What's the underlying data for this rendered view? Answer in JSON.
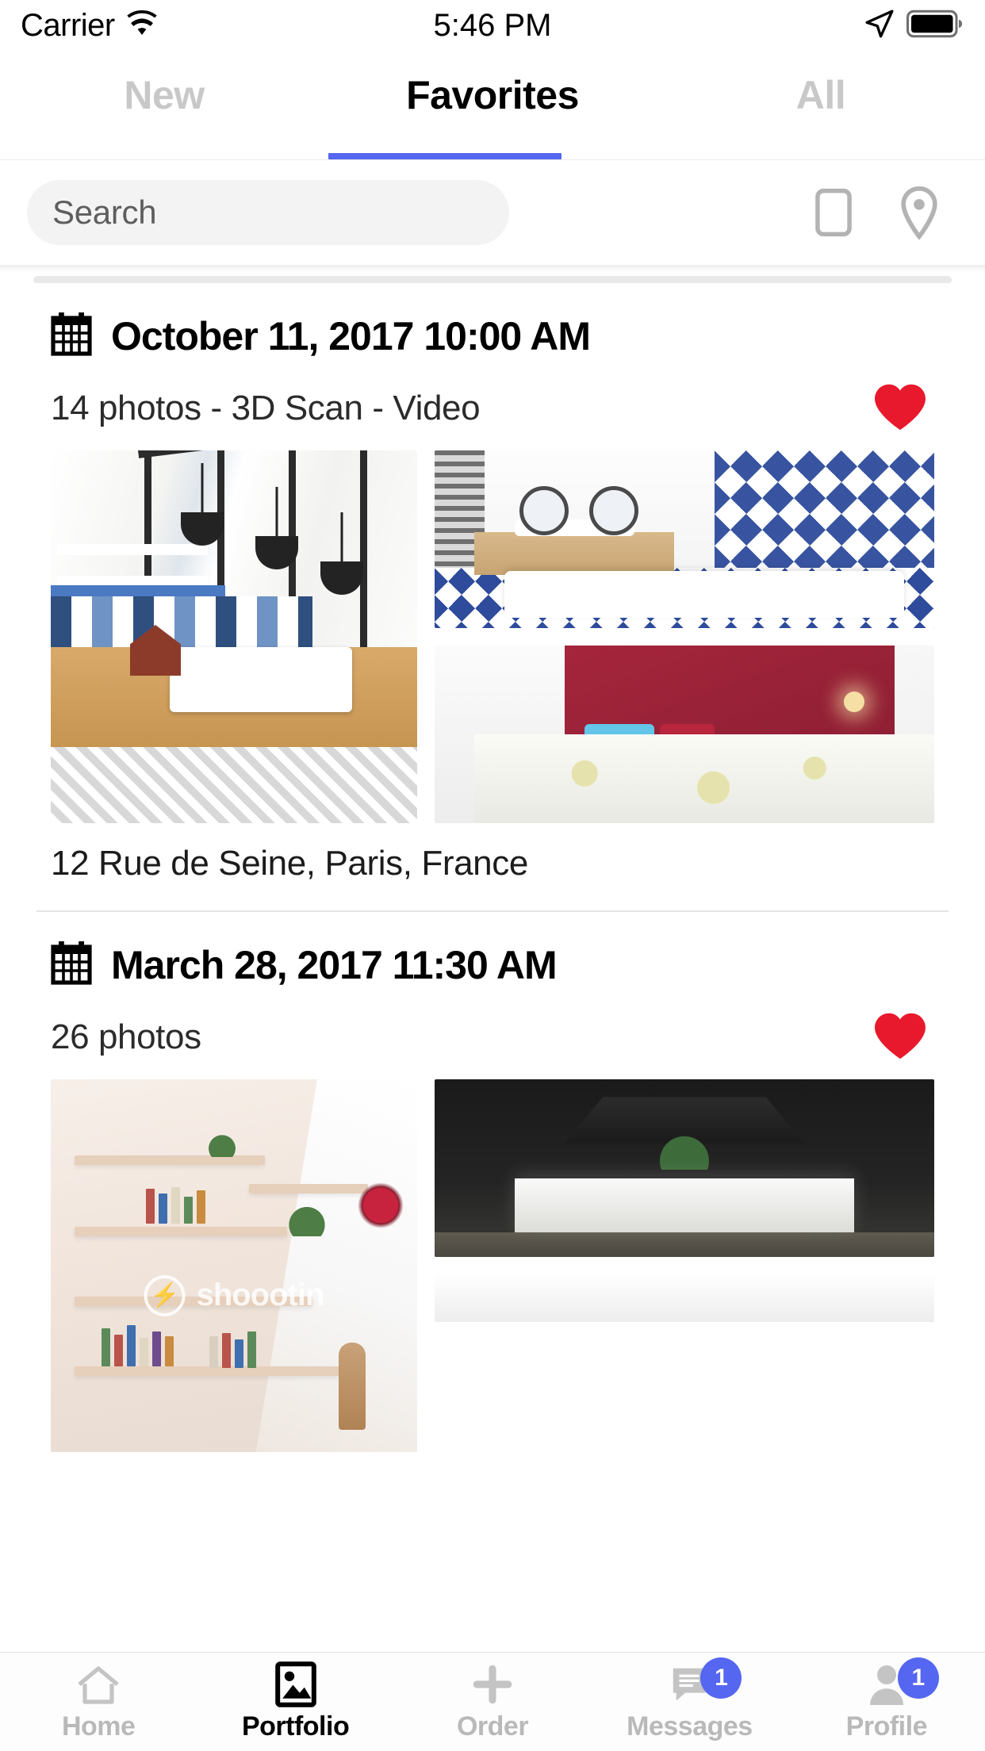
{
  "status_bar": {
    "carrier": "Carrier",
    "time": "5:46 PM",
    "wifi_icon": "wifi-icon",
    "location_icon": "location-arrow-icon",
    "battery_icon": "battery-full-icon"
  },
  "tabs": {
    "items": [
      {
        "label": "New",
        "active": false
      },
      {
        "label": "Favorites",
        "active": true
      },
      {
        "label": "All",
        "active": false
      }
    ],
    "active_indicator_color": "#5566f0"
  },
  "search": {
    "placeholder": "Search",
    "value": "",
    "actions": [
      {
        "name": "list-view-icon",
        "label": "List view"
      },
      {
        "name": "map-pin-icon",
        "label": "Map"
      }
    ]
  },
  "listings": [
    {
      "date": "October 11, 2017 10:00 AM",
      "meta": "14 photos - 3D Scan - Video",
      "address": "12 Rue de Seine, Paris, France",
      "favorite": true,
      "favorite_color": "#e8192c",
      "photos": [
        {
          "name": "kitchen-veranda-photo",
          "alt": "Kitchen with veranda windows"
        },
        {
          "name": "bathroom-photo",
          "alt": "Bathroom with blue patterned tiles"
        },
        {
          "name": "bedroom-photo",
          "alt": "Bedroom with red accent wall"
        }
      ]
    },
    {
      "date": "March 28, 2017 11:30 AM",
      "meta": "26 photos",
      "address": "",
      "favorite": true,
      "favorite_color": "#e8192c",
      "photos": [
        {
          "name": "library-shelves-photo",
          "alt": "Bookshelves under staircase"
        },
        {
          "name": "dark-kitchen-photo",
          "alt": "Dark modern kitchen island"
        },
        {
          "name": "light-room-photo",
          "alt": "Bright room partial view"
        }
      ],
      "watermark": "shoootin"
    }
  ],
  "bottom_nav": {
    "items": [
      {
        "label": "Home",
        "icon": "home-icon",
        "active": false,
        "badge": ""
      },
      {
        "label": "Portfolio",
        "icon": "photo-icon",
        "active": true,
        "badge": ""
      },
      {
        "label": "Order",
        "icon": "plus-icon",
        "active": false,
        "badge": ""
      },
      {
        "label": "Messages",
        "icon": "chat-icon",
        "active": false,
        "badge": "1"
      },
      {
        "label": "Profile",
        "icon": "person-icon",
        "active": false,
        "badge": "1"
      }
    ],
    "badge_color": "#5566f0"
  }
}
